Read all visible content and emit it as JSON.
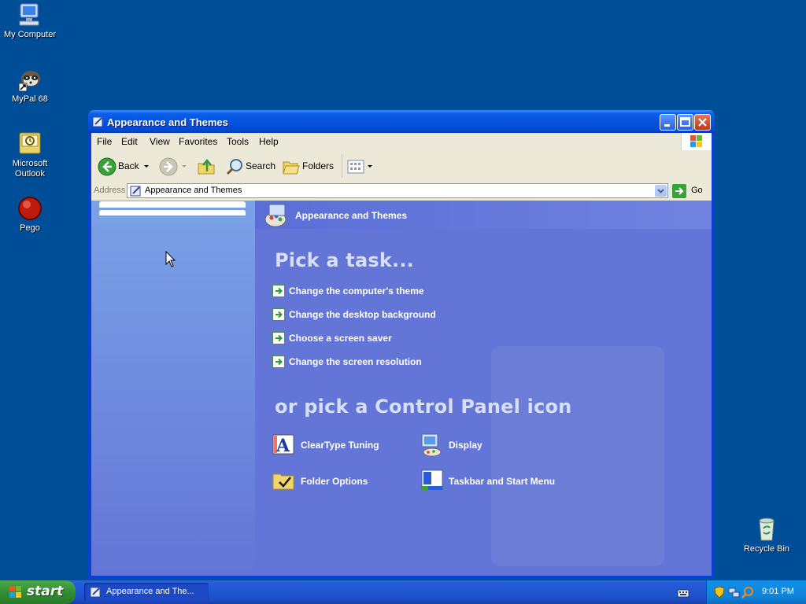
{
  "desktop": {
    "icons": [
      {
        "label": "My Computer"
      },
      {
        "label": "MyPal 68"
      },
      {
        "label": "Microsoft Outlook"
      },
      {
        "label": "Pego"
      },
      {
        "label": "Recycle Bin"
      }
    ]
  },
  "window": {
    "title": "Appearance and Themes",
    "menu": [
      "File",
      "Edit",
      "View",
      "Favorites",
      "Tools",
      "Help"
    ],
    "toolbar": {
      "back_label": "Back",
      "search_label": "Search",
      "folders_label": "Folders"
    },
    "address": {
      "label": "Address",
      "value": "Appearance and Themes",
      "go_label": "Go"
    },
    "content": {
      "header": "Appearance and Themes",
      "pick_task": "Pick a task...",
      "tasks": [
        "Change the computer's theme",
        "Change the desktop background",
        "Choose a screen saver",
        "Change the screen resolution"
      ],
      "pick_icon": "or pick a Control Panel icon",
      "cp_icons": [
        {
          "label": "ClearType Tuning"
        },
        {
          "label": "Display"
        },
        {
          "label": "Folder Options"
        },
        {
          "label": "Taskbar and Start Menu"
        }
      ]
    }
  },
  "taskbar": {
    "start_label": "start",
    "task_label": "Appearance and The...",
    "clock": "9:01 PM"
  },
  "colors": {
    "desktop": "#004e98",
    "content_bg": "#6375d6",
    "task_text": "#ffffff"
  }
}
